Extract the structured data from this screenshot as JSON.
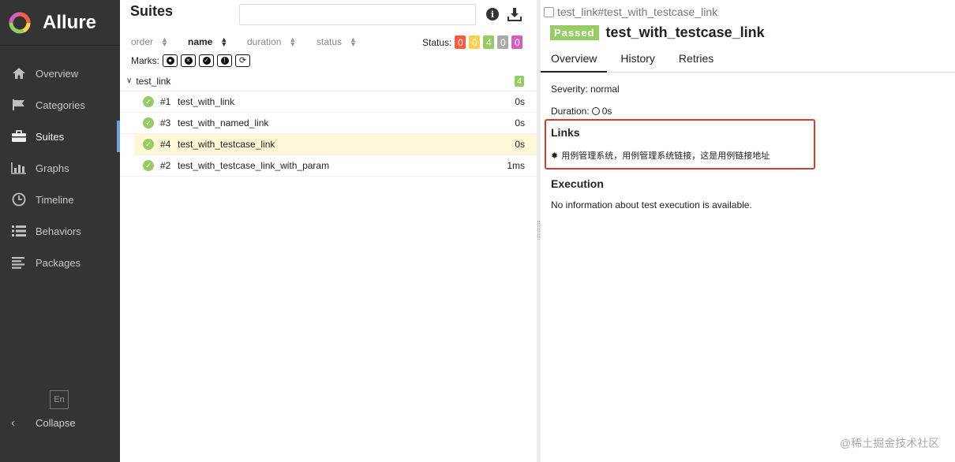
{
  "app": {
    "name": "Allure"
  },
  "sidebar": {
    "items": [
      {
        "label": "Overview",
        "icon": "home-icon"
      },
      {
        "label": "Categories",
        "icon": "flag-icon"
      },
      {
        "label": "Suites",
        "icon": "briefcase-icon",
        "active": true
      },
      {
        "label": "Graphs",
        "icon": "bar-chart-icon"
      },
      {
        "label": "Timeline",
        "icon": "clock-icon"
      },
      {
        "label": "Behaviors",
        "icon": "list-icon"
      },
      {
        "label": "Packages",
        "icon": "align-left-icon"
      }
    ],
    "lang": "En",
    "collapse": "Collapse"
  },
  "suites": {
    "title": "Suites",
    "search_placeholder": "",
    "sort": {
      "order": "order",
      "name": "name",
      "duration": "duration",
      "status": "status"
    },
    "status_label": "Status:",
    "status_counts": [
      {
        "value": "0",
        "color": "#fd5a3e"
      },
      {
        "value": "0",
        "color": "#ffd050"
      },
      {
        "value": "4",
        "color": "#97cc64"
      },
      {
        "value": "0",
        "color": "#aaaaaa"
      },
      {
        "value": "0",
        "color": "#d35ebe"
      }
    ],
    "marks_label": "Marks:",
    "group": {
      "name": "test_link",
      "count": "4"
    },
    "rows": [
      {
        "num": "#1",
        "name": "test_with_link",
        "duration": "0s"
      },
      {
        "num": "#3",
        "name": "test_with_named_link",
        "duration": "0s"
      },
      {
        "num": "#4",
        "name": "test_with_testcase_link",
        "duration": "0s",
        "selected": true
      },
      {
        "num": "#2",
        "name": "test_with_testcase_link_with_param",
        "duration": "1ms"
      }
    ]
  },
  "detail": {
    "breadcrumb": "test_link#test_with_testcase_link",
    "status": "Passed",
    "title": "test_with_testcase_link",
    "tabs": [
      "Overview",
      "History",
      "Retries"
    ],
    "severity": "Severity: normal",
    "duration_label": "Duration:",
    "duration_value": "0s",
    "links_heading": "Links",
    "link_text": "用例管理系统，用例管理系统链接，这是用例链接地址",
    "execution_heading": "Execution",
    "execution_text": "No information about test execution is available."
  },
  "watermark": "@稀土掘金技术社区"
}
